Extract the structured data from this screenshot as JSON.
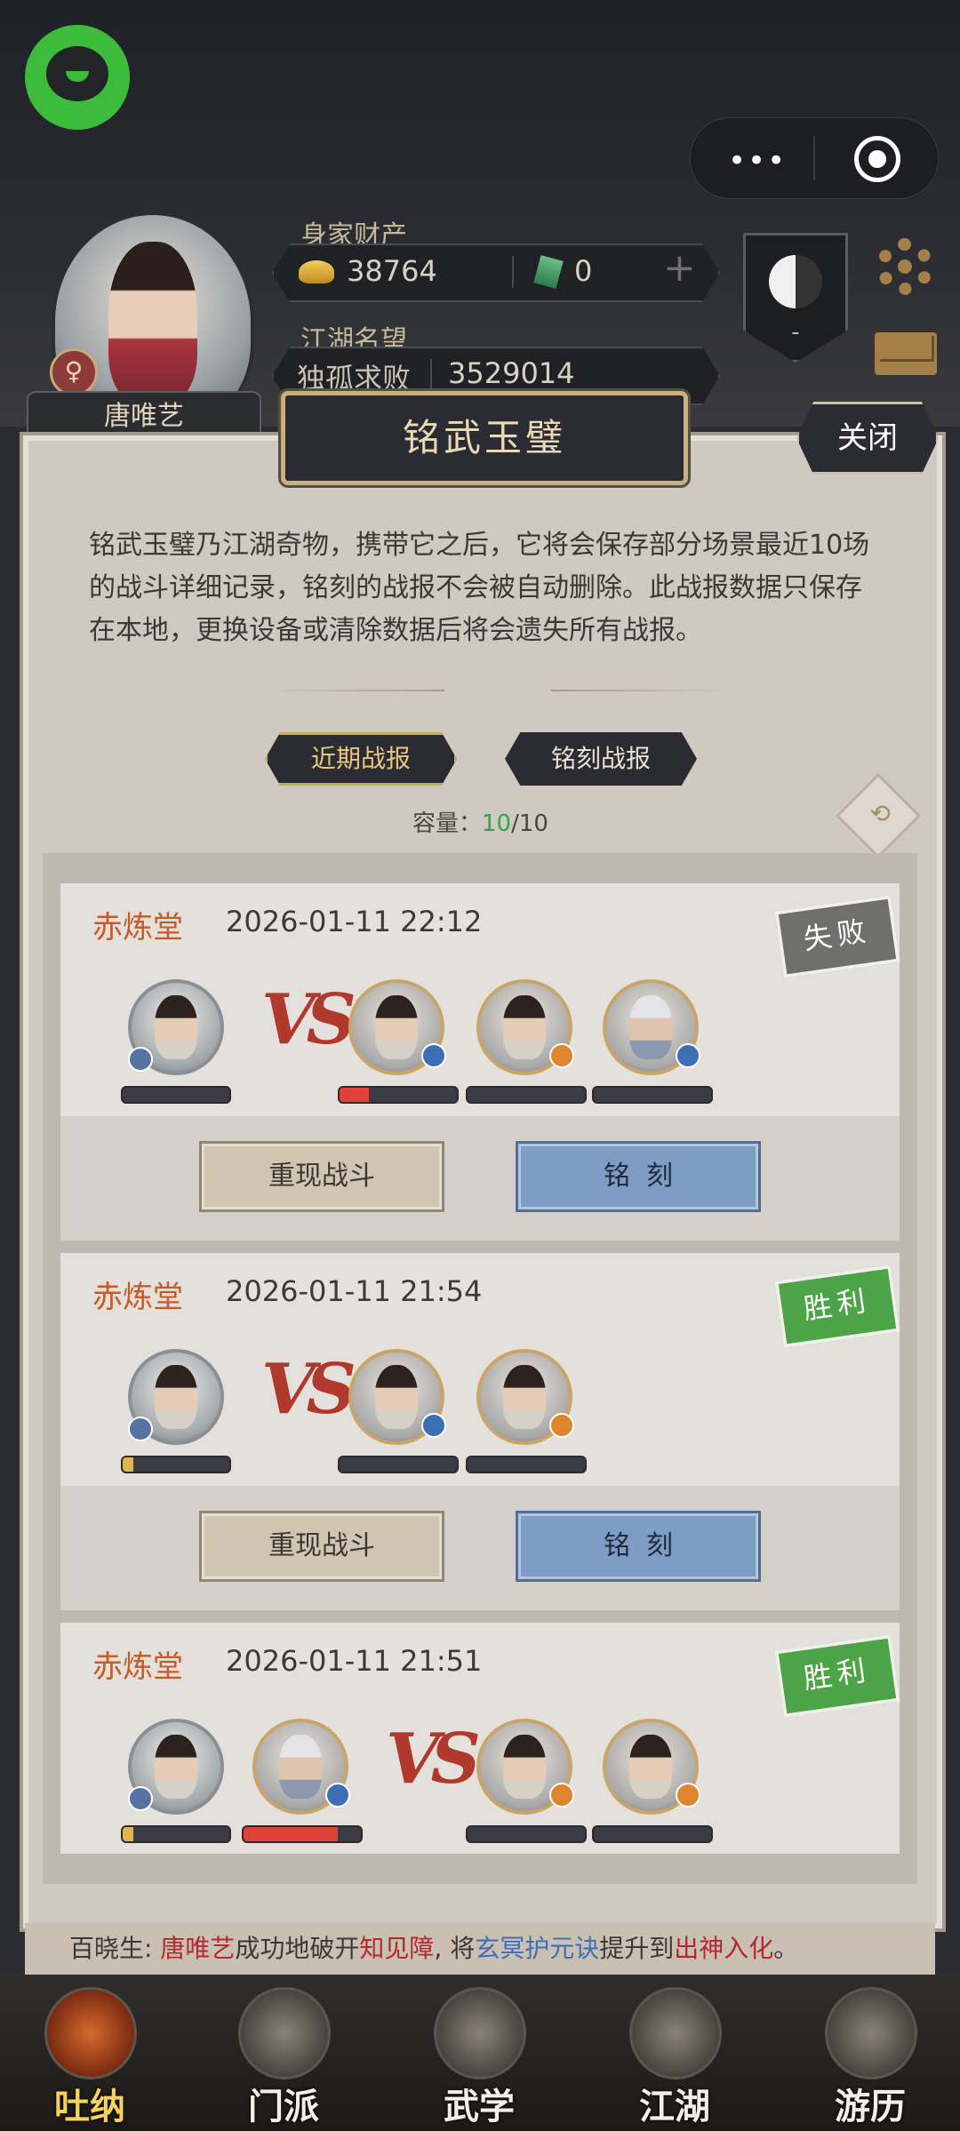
{
  "header": {
    "player_name": "唐唯艺",
    "wealth_label": "身家财产",
    "gold": "38764",
    "jade": "0",
    "reputation_label": "江湖名望",
    "reputation_title": "独孤求败",
    "reputation_value": "3529014",
    "rank_mark": "-",
    "gender_symbol": "♀",
    "capsule_dots": "•••",
    "add_symbol": "+"
  },
  "dialog": {
    "title": "铭武玉璧",
    "close_label": "关闭",
    "description": "铭武玉璧乃江湖奇物，携带它之后，它将会保存部分场景最近10场的战斗详细记录，铭刻的战报不会被自动删除。此战报数据只保存在本地，更换设备或清除数据后将会遗失所有战报。",
    "tabs": [
      {
        "label": "近期战报",
        "active": true
      },
      {
        "label": "铭刻战报",
        "active": false
      }
    ],
    "capacity_label": "容量：",
    "capacity_used": "10",
    "capacity_total": "/10",
    "refresh_icon_glyph": "⟲"
  },
  "battles": [
    {
      "location": "赤炼堂",
      "time": "2026-01-11 22:12",
      "result": "失败",
      "vs": "VS",
      "ally_hp": [
        0
      ],
      "enemy_hp": [
        0.25,
        0,
        0
      ],
      "replay_label": "重现战斗",
      "carve_label": "铭刻"
    },
    {
      "location": "赤炼堂",
      "time": "2026-01-11 21:54",
      "result": "胜利",
      "vs": "VS",
      "ally_hp": [
        0.1
      ],
      "enemy_hp": [
        0,
        0
      ],
      "replay_label": "重现战斗",
      "carve_label": "铭刻"
    },
    {
      "location": "赤炼堂",
      "time": "2026-01-11 21:51",
      "result": "胜利",
      "vs": "VS",
      "ally_hp": [
        0.1,
        0.8
      ],
      "enemy_hp": [
        0,
        0
      ]
    }
  ],
  "ticker": {
    "prefix": "百晓生: ",
    "name": "唐唯艺",
    "text1": "成功地破开",
    "obstacle": "知见障",
    "text2": ", 将",
    "skill": "玄冥护元诀",
    "text3": "提升到",
    "level": "出神入化",
    "suffix": "。"
  },
  "nav": [
    {
      "label": "吐纳",
      "icon": "meditation-icon",
      "active": true
    },
    {
      "label": "门派",
      "icon": "sect-flag-icon",
      "active": false
    },
    {
      "label": "武学",
      "icon": "scroll-book-icon",
      "active": false
    },
    {
      "label": "江湖",
      "icon": "hat-icon",
      "active": false
    },
    {
      "label": "游历",
      "icon": "horse-icon",
      "active": false
    }
  ],
  "colors": {
    "accent_orange": "#c85a25",
    "win_green": "#4da347",
    "lose_gray": "#6f6f6d",
    "carve_blue": "#7d9dc4",
    "hp_red": "#e04238",
    "hp_gold": "#e0b64e"
  }
}
